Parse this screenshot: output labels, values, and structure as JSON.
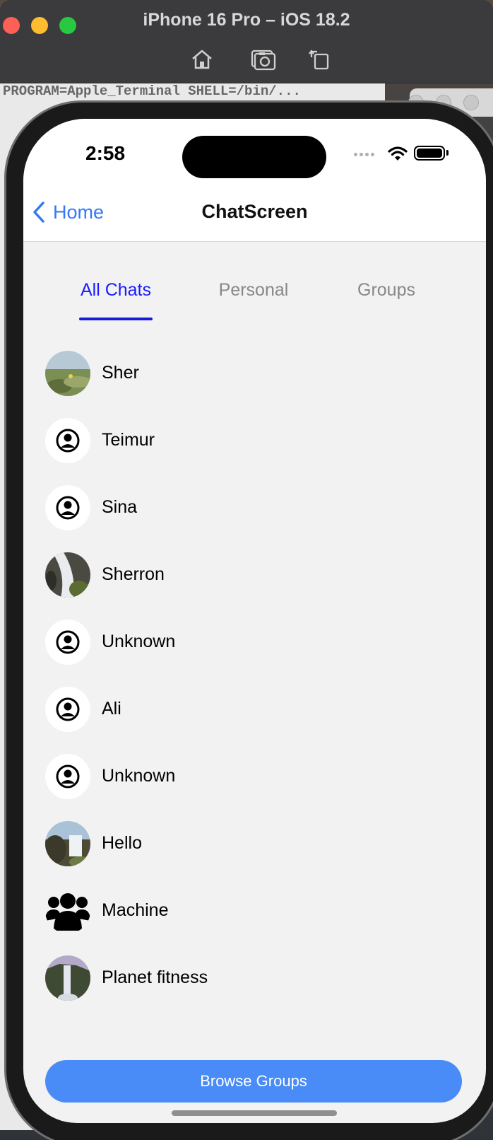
{
  "simulator": {
    "title": "iPhone 16 Pro – iOS 18.2",
    "tools": [
      {
        "icon": "home-icon"
      },
      {
        "icon": "screenshot-icon"
      },
      {
        "icon": "rotate-icon"
      }
    ]
  },
  "background": {
    "terminal_text": "PROGRAM=Apple_Terminal SHELL=/bin/..."
  },
  "status_bar": {
    "time": "2:58"
  },
  "nav": {
    "back_label": "Home",
    "title": "ChatScreen"
  },
  "tabs": [
    {
      "label": "All Chats",
      "active": true
    },
    {
      "label": "Personal",
      "active": false
    },
    {
      "label": "Groups",
      "active": false
    }
  ],
  "chats": [
    {
      "name": "Sher",
      "avatar": "photo-meadow"
    },
    {
      "name": "Teimur",
      "avatar": "default-user-icon"
    },
    {
      "name": "Sina",
      "avatar": "default-user-icon"
    },
    {
      "name": "Sherron",
      "avatar": "photo-waterfall"
    },
    {
      "name": "Unknown",
      "avatar": "default-user-icon"
    },
    {
      "name": "Ali",
      "avatar": "default-user-icon"
    },
    {
      "name": "Unknown",
      "avatar": "default-user-icon"
    },
    {
      "name": "Hello",
      "avatar": "photo-falls"
    },
    {
      "name": "Machine",
      "avatar": "group-icon"
    },
    {
      "name": "Planet fitness",
      "avatar": "photo-mountain-falls"
    }
  ],
  "browse_button": {
    "label": "Browse Groups"
  },
  "colors": {
    "accent_blue": "#3478f6",
    "active_tab": "#1a1aff",
    "button_bg": "#4a8cf7",
    "list_bg": "#f2f2f2"
  }
}
